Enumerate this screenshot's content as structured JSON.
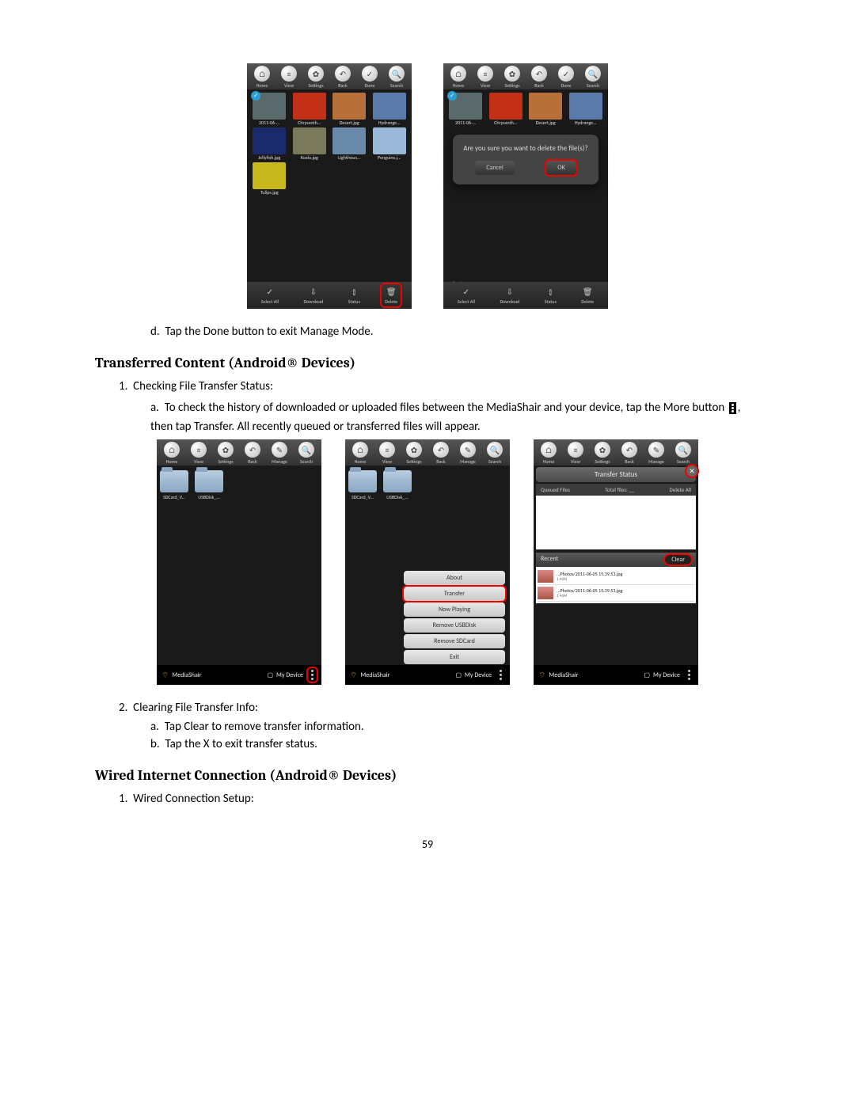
{
  "topToolbar": [
    "Home",
    "View",
    "Settings",
    "Back",
    "Done",
    "Search"
  ],
  "topToolbar2": [
    "Home",
    "View",
    "Settings",
    "Back",
    "Manage",
    "Search"
  ],
  "thumbs": [
    {
      "name": "2011-06-...",
      "color": "#5a6a6a"
    },
    {
      "name": "Chrysanth...",
      "color": "#c33018"
    },
    {
      "name": "Desert.jpg",
      "color": "#b8703a"
    },
    {
      "name": "Hydrange...",
      "color": "#5a7aaa"
    },
    {
      "name": "Jellyfish.jpg",
      "color": "#1a2a6a"
    },
    {
      "name": "Koala.jpg",
      "color": "#7a7a5a"
    },
    {
      "name": "Lighthous...",
      "color": "#6a8aaa"
    },
    {
      "name": "Penguins.j...",
      "color": "#9ab8d8"
    },
    {
      "name": "Tulips.jpg",
      "color": "#c8b820"
    }
  ],
  "bottomBar1": [
    "Select All",
    "Download",
    "Status",
    "Delete"
  ],
  "dialog": {
    "text": "Are you sure you want to delete the file(s)?",
    "cancel": "Cancel",
    "ok": "OK"
  },
  "step_d": "Tap the Done button to exit Manage Mode.",
  "heading1": "Transferred Content (Android® Devices)",
  "step1": "Checking File Transfer Status:",
  "step1a_1": "To check the history of downloaded or uploaded files between the MediaShair and your device, tap the More button ",
  "step1a_2": ", then tap Transfer.  All recently queued or transferred files will appear.",
  "folders": [
    "SDCard_V...",
    "USBDisk_..."
  ],
  "bottom2": {
    "mediashair": "MediaShair",
    "mydevice": "My Device"
  },
  "popup": [
    "About",
    "Transfer",
    "Now Playing",
    "Remove USBDisk",
    "Remove SDCard",
    "Exit"
  ],
  "ts": {
    "title": "Transfer Status",
    "queued": "Queued Files",
    "total": "Total files: __",
    "deleteAll": "Delete All",
    "recent": "Recent",
    "clear": "Clear",
    "items": [
      {
        "name": "...Photos/2011-06-05 15.39.53.jpg",
        "size": "1.46M"
      },
      {
        "name": "...Photos/2011-06-05 15.39.53.jpg",
        "size": "1.46M"
      }
    ]
  },
  "step2": "Clearing File Transfer Info:",
  "step2a": "Tap Clear to remove transfer information.",
  "step2b": "Tap the X to exit transfer status.",
  "heading2": "Wired Internet Connection (Android® Devices)",
  "step3": "Wired Connection Setup:",
  "pageNum": "59"
}
